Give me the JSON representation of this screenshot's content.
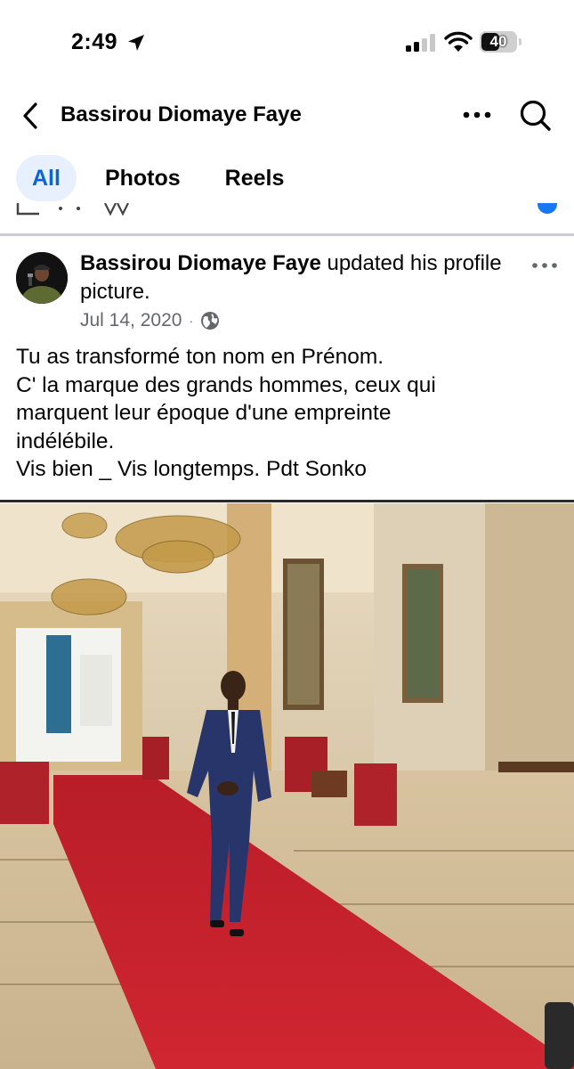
{
  "status_bar": {
    "time": "2:49",
    "battery_level": "40",
    "icons": [
      "location-arrow-icon",
      "cellular-signal-icon",
      "wifi-icon",
      "battery-icon"
    ]
  },
  "header": {
    "title": "Bassirou Diomaye Faye",
    "icons": [
      "back-chevron-icon",
      "more-dots-icon",
      "search-icon"
    ]
  },
  "tabs": [
    {
      "label": "All",
      "active": true
    },
    {
      "label": "Photos",
      "active": false
    },
    {
      "label": "Reels",
      "active": false
    }
  ],
  "post": {
    "author": "Bassirou Diomaye Faye",
    "action": "updated his profile picture.",
    "date": "Jul 14, 2020",
    "separator": "·",
    "privacy_icon": "globe-icon",
    "text_lines": [
      "Tu as transformé ton nom en Prénom.",
      "C' la marque des grands hommes, ceux qui",
      "marquent leur époque d'une empreinte",
      "indélébile.",
      "Vis bien _ Vis longtemps. Pdt Sonko"
    ]
  },
  "colors": {
    "accent": "#0a66d8",
    "tab_active_bg": "#e7f0fc",
    "meta_gray": "#65676b",
    "carpet_red": "#c8202b"
  }
}
